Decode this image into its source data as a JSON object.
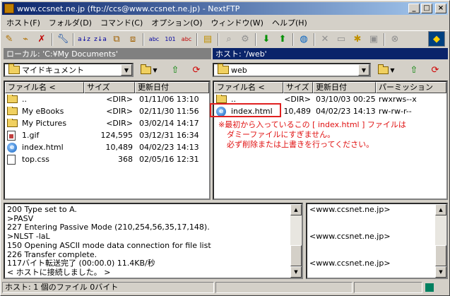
{
  "window": {
    "title": "www.ccsnet.ne.jp (ftp://ccs@www.ccsnet.ne.jp) - NextFTP"
  },
  "menu": [
    "ホスト(F)",
    "フォルダ(D)",
    "コマンド(C)",
    "オプション(O)",
    "ウィンドウ(W)",
    "ヘルプ(H)"
  ],
  "left_pane": {
    "header": "ローカル: 'C:¥My Documents'",
    "path": "マイドキュメント",
    "columns": [
      "ファイル名 <",
      "サイズ",
      "更新日付"
    ],
    "rows": [
      {
        "icon": "parent-folder-icon",
        "name": "..",
        "size": "<DIR>",
        "date": "01/11/06 13:10"
      },
      {
        "icon": "folder-icon",
        "name": "My eBooks",
        "size": "<DIR>",
        "date": "02/11/30 11:56"
      },
      {
        "icon": "folder-icon",
        "name": "My Pictures",
        "size": "<DIR>",
        "date": "03/02/14 14:17"
      },
      {
        "icon": "gif-file-icon",
        "name": "1.gif",
        "size": "124,595",
        "date": "03/12/31 16:34"
      },
      {
        "icon": "html-file-icon",
        "name": "index.html",
        "size": "10,489",
        "date": "04/02/23 14:13"
      },
      {
        "icon": "css-file-icon",
        "name": "top.css",
        "size": "368",
        "date": "02/05/16 12:31"
      }
    ]
  },
  "right_pane": {
    "header": "ホスト: '/web'",
    "path": "web",
    "columns": [
      "ファイル名 <",
      "サイズ",
      "更新日付",
      "パーミッション"
    ],
    "rows": [
      {
        "icon": "parent-folder-icon",
        "name": "..",
        "size": "<DIR>",
        "date": "03/10/03 00:25",
        "perm": "rwxrws--x"
      },
      {
        "icon": "html-file-icon",
        "name": "index.html",
        "size": "10,489",
        "date": "04/02/23 14:13",
        "perm": "rw-rw-r--"
      }
    ],
    "notice": [
      "※最初から入っているこの [ index.html ] ファイルは",
      "ダミーファイルにすぎません。",
      "必ず削除または上書きを行ってください。"
    ]
  },
  "log": [
    "200 Type set to A.",
    ">PASV",
    "227 Entering Passive Mode (210,254,56,35,17,148).",
    ">NLST -laL",
    "150 Opening ASCII mode data connection for file list",
    "226 Transfer complete.",
    "117バイト転送完了 (00:00.0) 11.4KB/秒",
    "< ホストに接続しました。 >"
  ],
  "right_log": [
    "<www.ccsnet.ne.jp>",
    "",
    "",
    "<www.ccsnet.ne.jp>",
    "",
    "",
    "<www.ccsnet.ne.jp>",
    ""
  ],
  "status": {
    "text": "ホスト: 1 個のファイル  0バイト"
  },
  "colors": {
    "active_header": "#0a246a",
    "inactive_header": "#808080",
    "notice": "#e01010"
  }
}
